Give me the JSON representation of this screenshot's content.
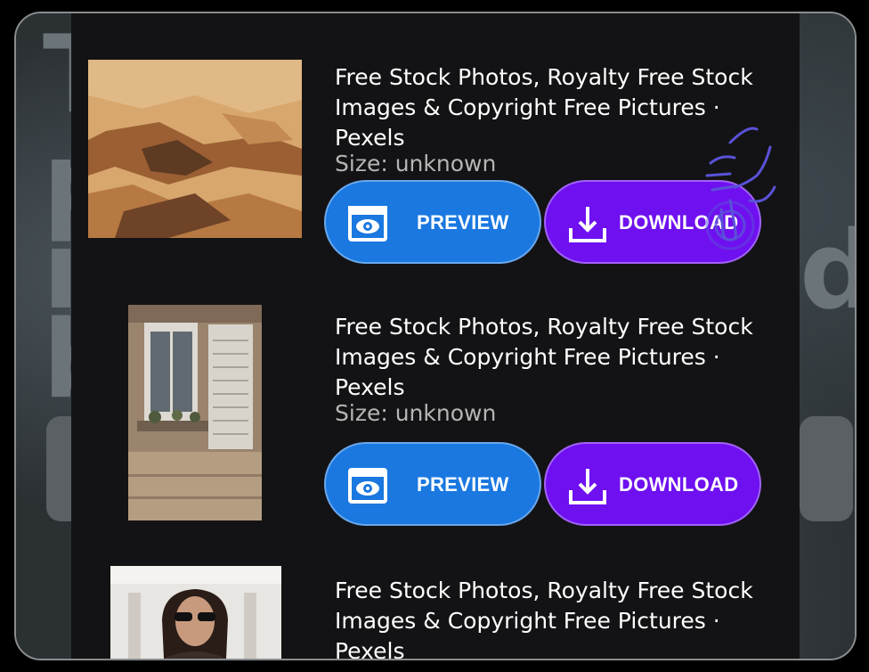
{
  "results": [
    {
      "title": "Free Stock Photos, Royalty Free Stock Images & Copyright Free Pictures · Pexels",
      "size": "Size: unknown",
      "preview_label": "PREVIEW",
      "download_label": "DOWNLOAD"
    },
    {
      "title": "Free Stock Photos, Royalty Free Stock Images & Copyright Free Pictures · Pexels",
      "size": "Size: unknown",
      "preview_label": "PREVIEW",
      "download_label": "DOWNLOAD"
    },
    {
      "title": "Free Stock Photos, Royalty Free Stock Images & Copyright Free Pictures · Pexels"
    }
  ],
  "colors": {
    "preview_button": "#1a78e0",
    "download_button": "#6f10f0",
    "panel_background": "#131315"
  },
  "icons": [
    "eye-icon",
    "download-icon",
    "tap-hand-icon"
  ]
}
